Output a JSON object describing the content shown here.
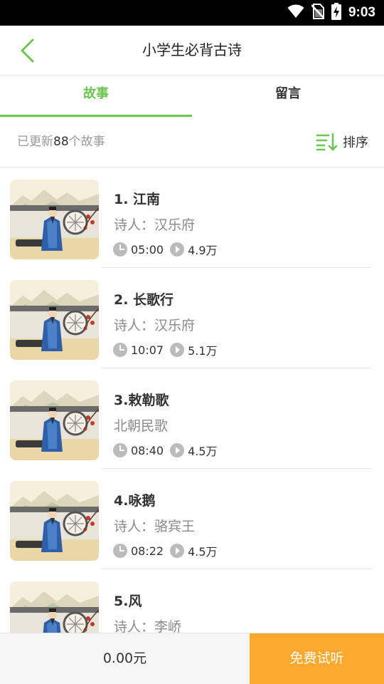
{
  "status_bar": {
    "time": "9:03",
    "icons": [
      "wifi-icon",
      "no-sim-icon",
      "battery-charging-icon"
    ]
  },
  "header": {
    "title": "小学生必背古诗",
    "back_icon": "chevron-left-icon"
  },
  "tabs": [
    {
      "label": "故事",
      "active": true
    },
    {
      "label": "留言",
      "active": false
    }
  ],
  "summary": {
    "prefix": "已更新",
    "count": "88",
    "suffix": "个故事",
    "sort_label": "排序",
    "sort_icon": "sort-icon"
  },
  "stories": [
    {
      "title": "1. 江南",
      "author": "诗人：汉乐府",
      "duration": "05:00",
      "plays": "4.9万"
    },
    {
      "title": "2. 长歌行",
      "author": "诗人：汉乐府",
      "duration": "10:07",
      "plays": "5.1万"
    },
    {
      "title": "3.敕勒歌",
      "author": "北朝民歌",
      "duration": "08:40",
      "plays": "4.5万"
    },
    {
      "title": "4.咏鹅",
      "author": "诗人：骆宾王",
      "duration": "08:22",
      "plays": "4.5万"
    },
    {
      "title": "5.风",
      "author": "诗人：李峤",
      "duration": "",
      "plays": ""
    }
  ],
  "bottom": {
    "price": "0.00元",
    "trial_label": "免费试听"
  },
  "colors": {
    "accent": "#6cc551",
    "orange": "#fbaa2f"
  }
}
